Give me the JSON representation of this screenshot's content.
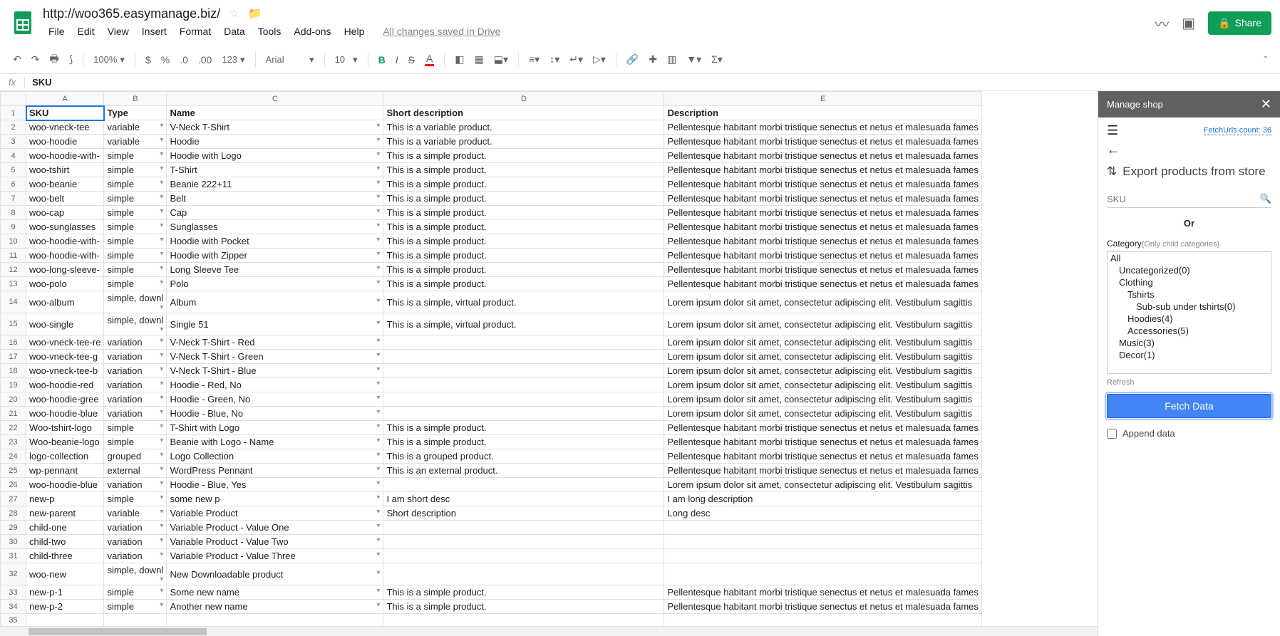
{
  "doc": {
    "title": "http://woo365.easymanage.biz/",
    "saved": "All changes saved in Drive",
    "share": "Share"
  },
  "menu": {
    "file": "File",
    "edit": "Edit",
    "view": "View",
    "insert": "Insert",
    "format": "Format",
    "data": "Data",
    "tools": "Tools",
    "addons": "Add-ons",
    "help": "Help"
  },
  "toolbar": {
    "zoom": "100%",
    "numfmt": "123",
    "font": "Arial",
    "size": "10"
  },
  "formula": {
    "fx": "fx",
    "value": "SKU"
  },
  "cols": [
    "A",
    "B",
    "C",
    "D",
    "E"
  ],
  "headers": {
    "sku": "SKU",
    "type": "Type",
    "name": "Name",
    "short": "Short description",
    "desc": "Description"
  },
  "lorem1": "Pellentesque habitant morbi tristique senectus et netus et malesuada fames",
  "lorem2": "Lorem ipsum dolor sit amet, consectetur adipiscing elit. Vestibulum sagittis",
  "simple_txt": "This is a simple product.",
  "variable_txt": "This is a variable product.",
  "virtual_txt": "This is a simple, virtual product.",
  "grouped_txt": "This is a grouped product.",
  "external_txt": "This is an external product.",
  "rows": [
    {
      "sku": "woo-vneck-tee",
      "type": "variable",
      "name": "V-Neck T-Shirt",
      "short": "variable_txt",
      "desc": "lorem1"
    },
    {
      "sku": "woo-hoodie",
      "type": "variable",
      "name": "Hoodie",
      "short": "variable_txt",
      "desc": "lorem1"
    },
    {
      "sku": "woo-hoodie-with-",
      "type": "simple",
      "name": "Hoodie with Logo",
      "short": "simple_txt",
      "desc": "lorem1"
    },
    {
      "sku": "woo-tshirt",
      "type": "simple",
      "name": "T-Shirt",
      "short": "simple_txt",
      "desc": "lorem1"
    },
    {
      "sku": "woo-beanie",
      "type": "simple",
      "name": "Beanie 222+11",
      "short": "simple_txt",
      "desc": "lorem1"
    },
    {
      "sku": "woo-belt",
      "type": "simple",
      "name": "Belt",
      "short": "simple_txt",
      "desc": "lorem1"
    },
    {
      "sku": "woo-cap",
      "type": "simple",
      "name": "Cap",
      "short": "simple_txt",
      "desc": "lorem1"
    },
    {
      "sku": "woo-sunglasses",
      "type": "simple",
      "name": "Sunglasses",
      "short": "simple_txt",
      "desc": "lorem1"
    },
    {
      "sku": "woo-hoodie-with-",
      "type": "simple",
      "name": "Hoodie with Pocket",
      "short": "simple_txt",
      "desc": "lorem1"
    },
    {
      "sku": "woo-hoodie-with-",
      "type": "simple",
      "name": "Hoodie with Zipper",
      "short": "simple_txt",
      "desc": "lorem1"
    },
    {
      "sku": "woo-long-sleeve-",
      "type": "simple",
      "name": "Long Sleeve Tee",
      "short": "simple_txt",
      "desc": "lorem1"
    },
    {
      "sku": "woo-polo",
      "type": "simple",
      "name": "Polo",
      "short": "simple_txt",
      "desc": "lorem1"
    },
    {
      "sku": "woo-album",
      "type": "simple, downl",
      "name": "Album",
      "short": "virtual_txt",
      "desc": "lorem2"
    },
    {
      "sku": "woo-single",
      "type": "simple, downl",
      "name": "Single 51",
      "short": "virtual_txt",
      "desc": "lorem2"
    },
    {
      "sku": "woo-vneck-tee-re",
      "type": "variation",
      "name": "V-Neck T-Shirt - Red",
      "short": "",
      "desc": "lorem2"
    },
    {
      "sku": "woo-vneck-tee-g",
      "type": "variation",
      "name": "V-Neck T-Shirt - Green",
      "short": "",
      "desc": "lorem2"
    },
    {
      "sku": "woo-vneck-tee-b",
      "type": "variation",
      "name": "V-Neck T-Shirt - Blue",
      "short": "",
      "desc": "lorem2"
    },
    {
      "sku": "woo-hoodie-red",
      "type": "variation",
      "name": "Hoodie - Red, No",
      "short": "",
      "desc": "lorem2"
    },
    {
      "sku": "woo-hoodie-gree",
      "type": "variation",
      "name": "Hoodie - Green, No",
      "short": "",
      "desc": "lorem2"
    },
    {
      "sku": "woo-hoodie-blue",
      "type": "variation",
      "name": "Hoodie - Blue, No",
      "short": "",
      "desc": "lorem2"
    },
    {
      "sku": "Woo-tshirt-logo",
      "type": "simple",
      "name": "T-Shirt with Logo",
      "short": "simple_txt",
      "desc": "lorem1"
    },
    {
      "sku": "Woo-beanie-logo",
      "type": "simple",
      "name": "Beanie with Logo - Name",
      "short": "simple_txt",
      "desc": "lorem1"
    },
    {
      "sku": "logo-collection",
      "type": "grouped",
      "name": "Logo Collection",
      "short": "grouped_txt",
      "desc": "lorem1"
    },
    {
      "sku": "wp-pennant",
      "type": "external",
      "name": "WordPress Pennant",
      "short": "external_txt",
      "desc": "lorem1"
    },
    {
      "sku": "woo-hoodie-blue",
      "type": "variation",
      "name": "Hoodie - Blue, Yes",
      "short": "",
      "desc": "lorem2"
    },
    {
      "sku": "new-p",
      "type": "simple",
      "name": "some new p",
      "short_raw": "I am short desc",
      "desc_raw": "I am long description"
    },
    {
      "sku": "new-parent",
      "type": "variable",
      "name": "Variable Product",
      "short_raw": "Short description",
      "desc_raw": "Long desc"
    },
    {
      "sku": "child-one",
      "type": "variation",
      "name": "Variable Product - Value One",
      "short": "",
      "desc": ""
    },
    {
      "sku": "child-two",
      "type": "variation",
      "name": "Variable Product - Value Two",
      "short": "",
      "desc": ""
    },
    {
      "sku": "child-three",
      "type": "variation",
      "name": "Variable Product - Value Three",
      "short": "",
      "desc": ""
    },
    {
      "sku": "woo-new",
      "type": "simple, downl",
      "name": "New Downloadable product",
      "short": "",
      "desc": ""
    },
    {
      "sku": "new-p-1",
      "type": "simple",
      "name": "Some new name",
      "short": "simple_txt",
      "desc": "lorem1"
    },
    {
      "sku": "new-p-2",
      "type": "simple",
      "name": "Another new name",
      "short": "simple_txt",
      "desc": "lorem1"
    }
  ],
  "panel": {
    "title": "Manage shop",
    "fetch_count": "FetchUrls count: 36",
    "export_title": "Export products from store",
    "sku_placeholder": "SKU",
    "or": "Or",
    "cat_label": "Category",
    "cat_hint": "(Only child categories)",
    "refresh": "Refresh",
    "fetch": "Fetch Data",
    "append": "Append data",
    "cats": [
      {
        "label": "All",
        "cls": ""
      },
      {
        "label": "Uncategorized(0)",
        "cls": "ind1"
      },
      {
        "label": "Clothing",
        "cls": "ind1"
      },
      {
        "label": "Tshirts",
        "cls": "ind2"
      },
      {
        "label": "Sub-sub under tshirts(0)",
        "cls": "ind3"
      },
      {
        "label": "Hoodies(4)",
        "cls": "ind2"
      },
      {
        "label": "Accessories(5)",
        "cls": "ind2"
      },
      {
        "label": "Music(3)",
        "cls": "ind1"
      },
      {
        "label": "Decor(1)",
        "cls": "ind1"
      }
    ]
  }
}
